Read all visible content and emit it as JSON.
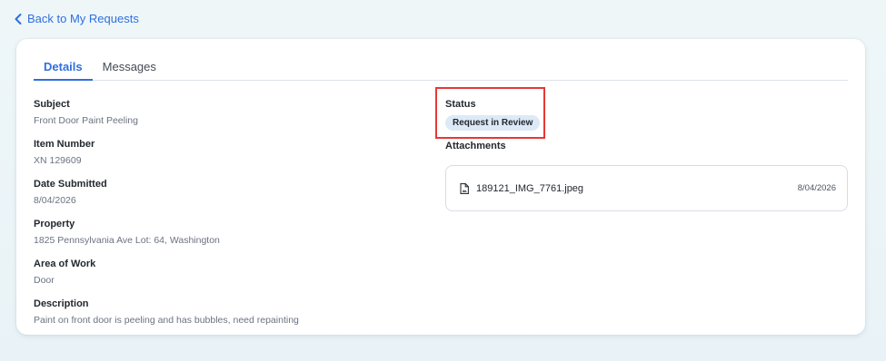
{
  "nav": {
    "back_label": "Back to My Requests"
  },
  "tabs": [
    {
      "label": "Details",
      "active": true
    },
    {
      "label": "Messages",
      "active": false
    }
  ],
  "details": {
    "subject_label": "Subject",
    "subject_value": "Front Door Paint Peeling",
    "item_number_label": "Item Number",
    "item_number_value": "XN 129609",
    "date_label": "Date Submitted",
    "date_value": "8/04/2026",
    "property_label": "Property",
    "property_value": "1825 Pennsylvania Ave Lot: 64, Washington",
    "area_label": "Area of Work",
    "area_value": "Door",
    "description_label": "Description",
    "description_value": "Paint on front door is peeling and has bubbles, need repainting"
  },
  "status": {
    "label": "Status",
    "badge": "Request in Review",
    "badge_color": "#dde9f7"
  },
  "attachments": {
    "label": "Attachments",
    "items": [
      {
        "name": "189121_IMG_7761.jpeg",
        "date": "8/04/2026",
        "icon": "image-file-icon"
      }
    ]
  },
  "colors": {
    "accent": "#2f6fe0",
    "highlight_border": "#e53935"
  }
}
